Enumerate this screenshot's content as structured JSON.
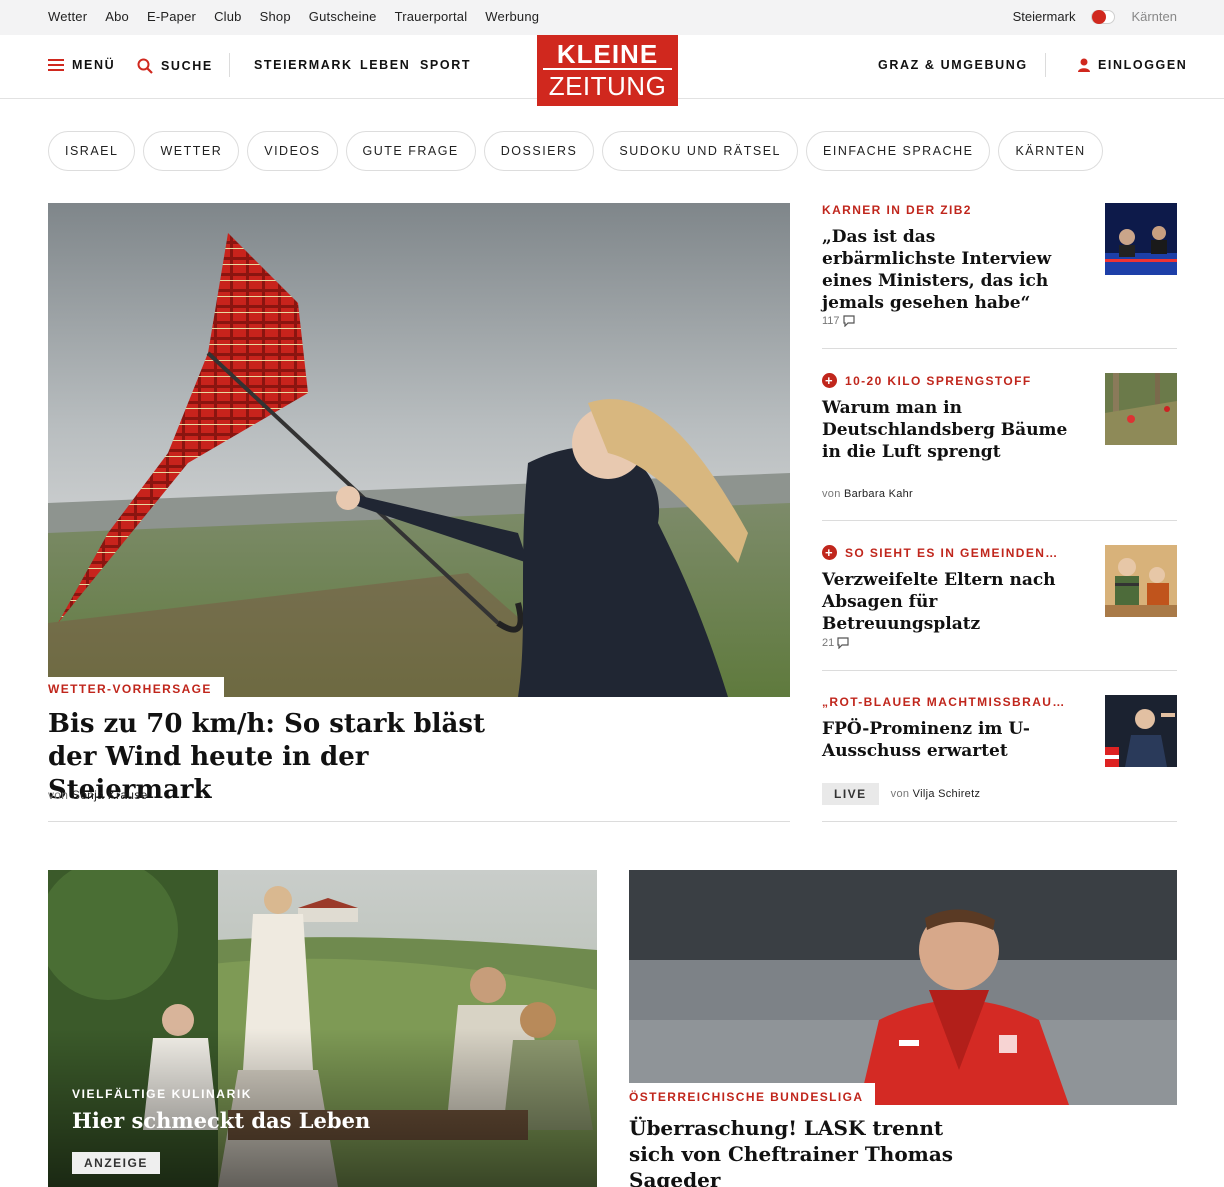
{
  "topbar": {
    "links": [
      "Wetter",
      "Abo",
      "E-Paper",
      "Club",
      "Shop",
      "Gutscheine",
      "Trauerportal",
      "Werbung"
    ],
    "region_left": "Steiermark",
    "region_right": "Kärnten"
  },
  "header": {
    "menu_label": "MENÜ",
    "search_label": "SUCHE",
    "nav": [
      "STEIERMARK",
      "LEBEN",
      "SPORT"
    ],
    "logo_top": "KLEINE",
    "logo_bottom": "ZEITUNG",
    "region_label": "GRAZ & UMGEBUNG",
    "login_label": "EINLOGGEN"
  },
  "chips": [
    "ISRAEL",
    "WETTER",
    "VIDEOS",
    "GUTE FRAGE",
    "DOSSIERS",
    "SUDOKU UND RÄTSEL",
    "EINFACHE SPRACHE",
    "KÄRNTEN"
  ],
  "hero": {
    "kicker": "WETTER-VORHERSAGE",
    "title": "Bis zu 70 km/h: So stark bläst der Wind heute in der Steiermark",
    "by": "von",
    "author": "Sonja Krause"
  },
  "side": [
    {
      "kicker": "KARNER IN DER ZIB2",
      "title": "„Das ist das erbärmlichste Interview eines Ministers, das ich jemals gesehen habe“",
      "comments": "117"
    },
    {
      "kicker": "10-20 KILO SPRENGSTOFF",
      "title": "Warum man in Deutschlandsberg Bäume in die Luft sprengt",
      "by": "von",
      "author": "Barbara Kahr"
    },
    {
      "kicker": "SO SIEHT ES IN GEMEINDEN…",
      "title": "Verzweifelte Eltern nach Absagen für Betreuungsplatz",
      "comments": "21"
    },
    {
      "kicker": "„ROT-BLAUER MACHTMISSBRAU…",
      "title": "FPÖ-Prominenz im U-Ausschuss erwartet",
      "live": "LIVE",
      "by": "von",
      "author": "Vilja Schiretz"
    }
  ],
  "cards": {
    "ad": {
      "kicker": "VIELFÄLTIGE KULINARIK",
      "title": "Hier schmeckt das Leben",
      "badge": "ANZEIGE"
    },
    "sport": {
      "kicker": "ÖSTERREICHISCHE BUNDESLIGA",
      "title": "Überraschung! LASK trennt sich von Cheftrainer Thomas Sageder"
    }
  },
  "colors": {
    "brand_red": "#d0281e",
    "kicker_red": "#c0261c",
    "topbar_bg": "#f3f3f4"
  }
}
